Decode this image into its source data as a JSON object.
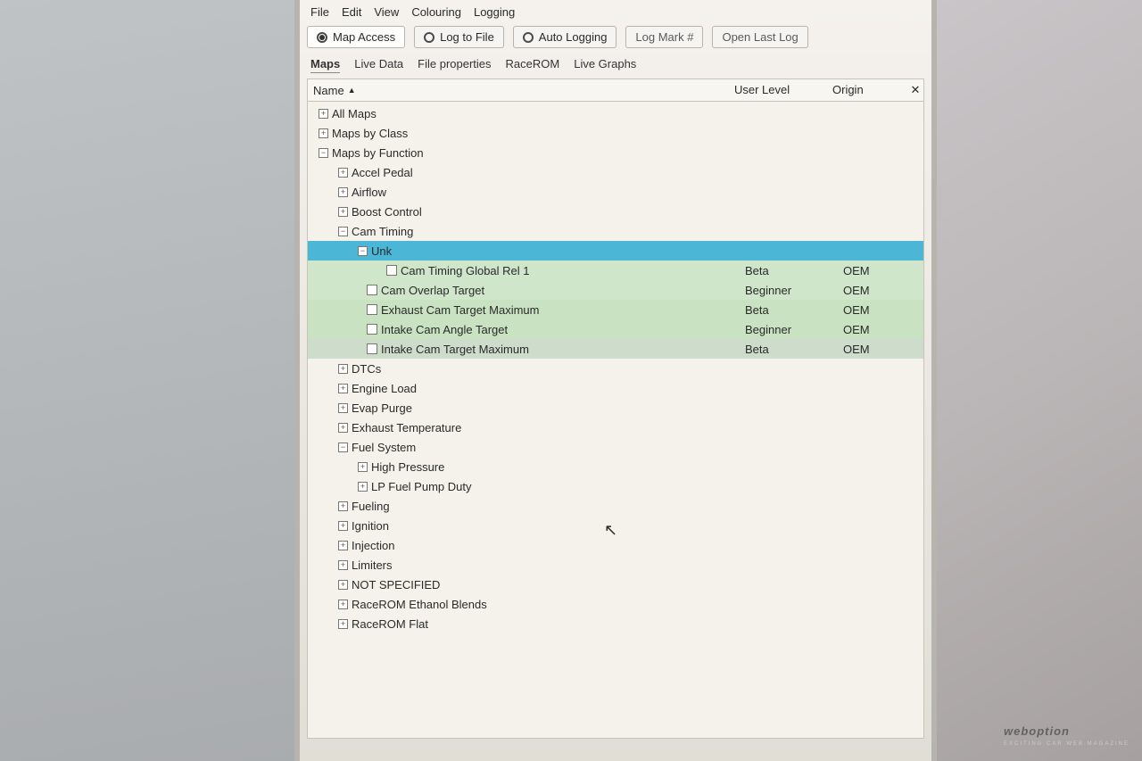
{
  "menubar": {
    "file": "File",
    "edit": "Edit",
    "view": "View",
    "colouring": "Colouring",
    "logging": "Logging"
  },
  "toolbar": {
    "map_access": "Map Access",
    "log_to_file": "Log to File",
    "auto_logging": "Auto Logging",
    "log_mark": "Log Mark #",
    "open_last": "Open Last Log"
  },
  "tabs": {
    "maps": "Maps",
    "live_data": "Live Data",
    "file_props": "File properties",
    "racerom": "RaceROM",
    "live_graphs": "Live Graphs"
  },
  "columns": {
    "name": "Name",
    "user_level": "User Level",
    "origin": "Origin"
  },
  "tree": {
    "all_maps": "All Maps",
    "maps_by_class": "Maps by Class",
    "maps_by_function": "Maps by Function",
    "accel_pedal": "Accel Pedal",
    "airflow": "Airflow",
    "boost_control": "Boost Control",
    "cam_timing": "Cam Timing",
    "unk": "Unk",
    "cam_timing_global": "Cam Timing Global Rel 1",
    "cam_overlap_target": "Cam Overlap Target",
    "exhaust_cam_target_max": "Exhaust Cam Target Maximum",
    "intake_cam_angle_target": "Intake Cam Angle Target",
    "intake_cam_target_max": "Intake Cam Target Maximum",
    "dtcs": "DTCs",
    "engine_load": "Engine Load",
    "evap_purge": "Evap Purge",
    "exhaust_temperature": "Exhaust Temperature",
    "fuel_system": "Fuel System",
    "high_pressure": "High Pressure",
    "lp_fuel_pump": "LP Fuel Pump Duty",
    "fueling": "Fueling",
    "ignition": "Ignition",
    "injection": "Injection",
    "limiters": "Limiters",
    "not_specified": "NOT SPECIFIED",
    "racerom_eth": "RaceROM Ethanol Blends",
    "racerom_flat": "RaceROM Flat"
  },
  "levels": {
    "beta": "Beta",
    "beginner": "Beginner"
  },
  "origins": {
    "oem": "OEM"
  },
  "watermark": {
    "brand": "weboption",
    "tag": "EXCITING CAR WEB MAGAZINE"
  }
}
